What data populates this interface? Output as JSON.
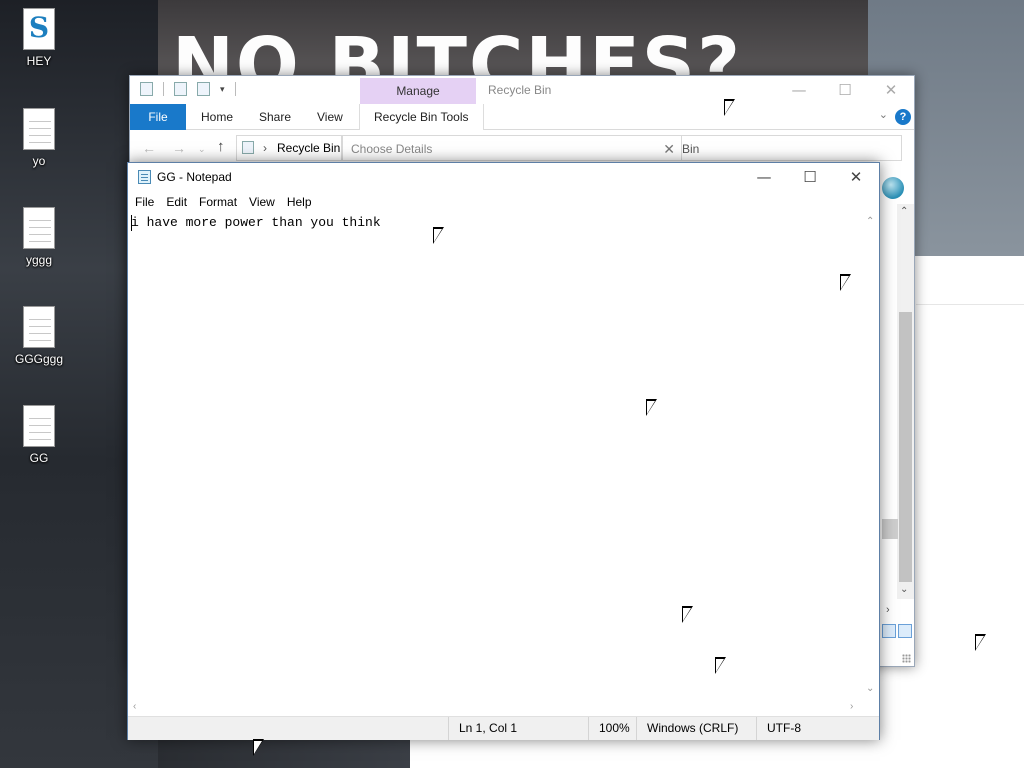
{
  "wallpaper": {
    "meme_text": "NO BITCHES?"
  },
  "desktop_icons": [
    {
      "label": "HEY",
      "icon": "setup-script-icon"
    },
    {
      "label": "yo",
      "icon": "text-file-icon"
    },
    {
      "label": "yggg",
      "icon": "text-file-icon"
    },
    {
      "label": "GGGggg",
      "icon": "text-file-icon"
    },
    {
      "label": "GG",
      "icon": "text-file-icon"
    }
  ],
  "explorer": {
    "title": "Recycle Bin",
    "manage_tab": "Manage",
    "ribbon_tabs": [
      "File",
      "Home",
      "Share",
      "View",
      "Recycle Bin Tools"
    ],
    "address_path": "Recycle Bin",
    "search_placeholder": "Choose Details",
    "address_tail": "Bin",
    "accent": "#1979ca",
    "manage_color": "#e5d1f4"
  },
  "notepad": {
    "title": "GG - Notepad",
    "menu": [
      "File",
      "Edit",
      "Format",
      "View",
      "Help"
    ],
    "content": "i have more power than you think",
    "status": {
      "position": "Ln 1, Col 1",
      "zoom": "100%",
      "line_ending": "Windows (CRLF)",
      "encoding": "UTF-8"
    }
  }
}
